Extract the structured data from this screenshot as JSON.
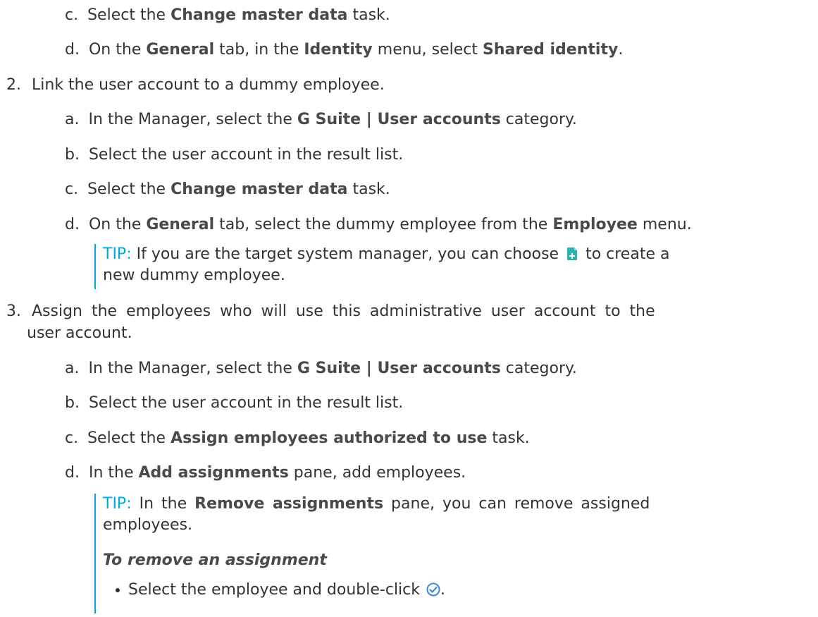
{
  "step1": {
    "c": {
      "letter": "c.",
      "pre": "Select the ",
      "bold": "Change master data",
      "post": " task."
    },
    "d": {
      "letter": "d.",
      "pre": "On the ",
      "bold1": "General",
      "mid1": " tab, in the ",
      "bold2": "Identity",
      "mid2": " menu, select ",
      "bold3": "Shared identity",
      "post": "."
    }
  },
  "step2": {
    "num": "2.",
    "text": "Link the user account to a dummy employee.",
    "a": {
      "letter": "a.",
      "pre": "In the Manager, select the ",
      "bold": "G Suite | User accounts",
      "post": " category."
    },
    "b": {
      "letter": "b.",
      "text": "Select the user account in the result list."
    },
    "c": {
      "letter": "c.",
      "pre": "Select the ",
      "bold": "Change master data",
      "post": " task."
    },
    "d": {
      "letter": "d.",
      "pre": "On the ",
      "bold1": "General",
      "mid": " tab, select the dummy employee from the ",
      "bold2": "Employee",
      "post": " menu."
    },
    "tip": {
      "label": "TIP:",
      "line1_pre": " If you are the target system manager, you can choose ",
      "line1_post": " to create a",
      "line2": "new dummy employee."
    }
  },
  "step3": {
    "num": "3.",
    "line1": "Assign the employees who will use this administrative user account to the",
    "line2": "user  account.",
    "a": {
      "letter": "a.",
      "pre": "In the Manager, select the ",
      "bold": "G Suite | User accounts",
      "post": " category."
    },
    "b": {
      "letter": "b.",
      "text": "Select the user account in the result list."
    },
    "c": {
      "letter": "c.",
      "pre": "Select the ",
      "bold": "Assign employees authorized to use",
      "post": " task."
    },
    "d": {
      "letter": "d.",
      "pre": "In the ",
      "bold": "Add assignments",
      "post": " pane, add employees."
    },
    "tip": {
      "label": "TIP:",
      "line1_pre": " In the ",
      "line1_bold": "Remove assignments",
      "line1_post": " pane, you can remove assigned",
      "line2": "employees.",
      "heading": "To remove an assignment",
      "bullet": "Select the employee and double-click ",
      "bullet_end": "."
    }
  },
  "icons": {
    "add": "add-document-icon",
    "check": "check-circle-icon"
  },
  "colors": {
    "tip": "#00a9e0",
    "text": "#333333",
    "add_icon": "#2bb3b1",
    "check_icon": "#3a8ad8"
  }
}
